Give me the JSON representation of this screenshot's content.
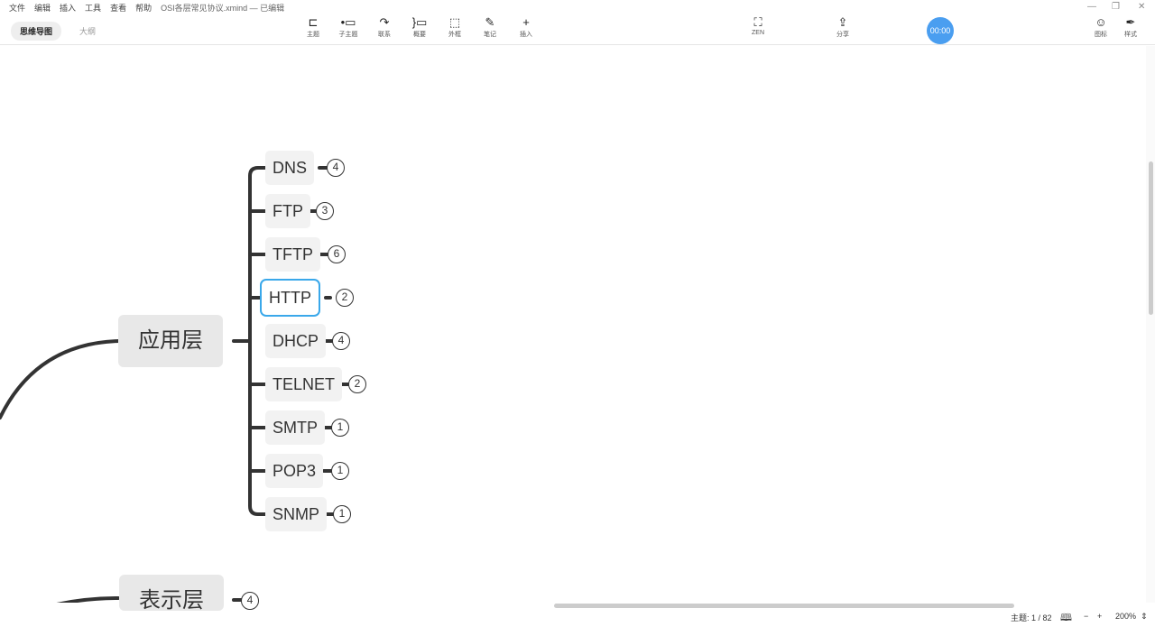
{
  "menu": [
    "文件",
    "编辑",
    "插入",
    "工具",
    "查看",
    "帮助"
  ],
  "doc_title": "OSI各层常见协议.xmind — 已编辑",
  "view_tabs": {
    "mindmap": "思维导图",
    "outline": "大纲"
  },
  "toolbar": [
    {
      "label": "主题",
      "icon": "topic-icon"
    },
    {
      "label": "子主题",
      "icon": "subtopic-icon"
    },
    {
      "label": "联系",
      "icon": "relationship-icon"
    },
    {
      "label": "概要",
      "icon": "summary-icon"
    },
    {
      "label": "外框",
      "icon": "boundary-icon"
    },
    {
      "label": "笔记",
      "icon": "note-icon"
    },
    {
      "label": "插入",
      "icon": "plus-icon"
    }
  ],
  "zen": "ZEN",
  "share": "分享",
  "timer": "00:00",
  "right_panel": {
    "icon": "图标",
    "style": "样式"
  },
  "mindmap": {
    "main": "应用层",
    "next": "表示层",
    "next_count": "4",
    "children": [
      {
        "t": "DNS",
        "n": "4"
      },
      {
        "t": "FTP",
        "n": "3"
      },
      {
        "t": "TFTP",
        "n": "6"
      },
      {
        "t": "HTTP",
        "n": "2"
      },
      {
        "t": "DHCP",
        "n": "4"
      },
      {
        "t": "TELNET",
        "n": "2"
      },
      {
        "t": "SMTP",
        "n": "1"
      },
      {
        "t": "POP3",
        "n": "1"
      },
      {
        "t": "SNMP",
        "n": "1"
      }
    ],
    "selected": "HTTP"
  },
  "status": {
    "topics": "主题: 1 / 82",
    "zoom": "200%"
  }
}
